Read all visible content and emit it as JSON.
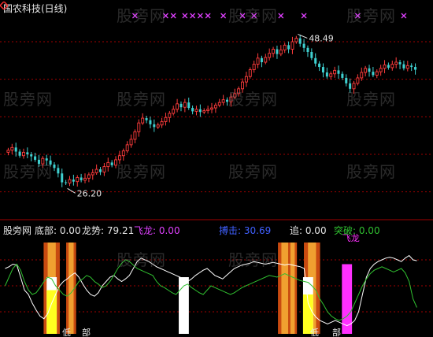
{
  "window": {
    "title": "国农科技(日线)"
  },
  "watermark": "股旁网",
  "colors": {
    "up": "#ff3c3c",
    "down": "#3fd0d0",
    "grid": "#a00000",
    "signal": "#e040ff",
    "line_white": "#ffffff",
    "line_green": "#30c030"
  },
  "chart_data": [
    {
      "type": "candlestick",
      "title": "国农科技(日线)",
      "ylim": [
        22,
        52
      ],
      "grid_levels": [
        25.5,
        31.0,
        36.5,
        42.0,
        47.5
      ],
      "annotations": {
        "high_label": "48.49",
        "low_label": "26.20"
      },
      "signal_markers": [
        33,
        41,
        43,
        46,
        48,
        50,
        52,
        56,
        61,
        64,
        71,
        77,
        91,
        103
      ],
      "closes": [
        31.6,
        32.0,
        31.4,
        30.8,
        31.3,
        31.0,
        30.7,
        30.2,
        29.6,
        30.4,
        30.1,
        29.5,
        29.0,
        28.2,
        26.9,
        26.8,
        27.3,
        27.0,
        27.6,
        27.2,
        27.5,
        28.0,
        28.3,
        28.8,
        28.4,
        29.2,
        29.8,
        29.4,
        30.2,
        30.8,
        31.5,
        32.4,
        33.2,
        34.3,
        35.6,
        36.3,
        36.0,
        35.4,
        35.0,
        35.3,
        35.8,
        36.4,
        37.0,
        37.6,
        38.4,
        37.9,
        38.6,
        37.8,
        37.3,
        37.6,
        37.2,
        37.4,
        37.6,
        37.8,
        38.2,
        38.6,
        39.0,
        38.7,
        39.4,
        39.9,
        40.6,
        41.6,
        42.4,
        43.4,
        44.2,
        45.1,
        44.5,
        45.2,
        45.8,
        46.4,
        45.7,
        46.3,
        47.0,
        46.4,
        47.5,
        48.0,
        47.2,
        46.6,
        46.0,
        45.1,
        44.3,
        43.8,
        43.0,
        42.4,
        42.8,
        43.3,
        42.8,
        42.2,
        41.4,
        40.6,
        41.4,
        42.2,
        43.0,
        43.6,
        43.1,
        42.6,
        43.1,
        43.6,
        44.1,
        43.7,
        44.2,
        44.5,
        44.2,
        43.6,
        44.0,
        43.8,
        43.4
      ]
    },
    {
      "type": "line",
      "legend": [
        {
          "label": "股旁网",
          "value": "",
          "color": "#e6e6e6"
        },
        {
          "label": "底部:",
          "value": "0.00",
          "color": "#e6e6e6"
        },
        {
          "label": "龙势:",
          "value": "79.21",
          "color": "#e6e6e6"
        },
        {
          "label": "飞龙:",
          "value": "0.00",
          "color": "#e040ff"
        },
        {
          "label": "搏击:",
          "value": "30.69",
          "color": "#4060ff"
        },
        {
          "label": "追:",
          "value": "0.00",
          "color": "#e6e6e6"
        },
        {
          "label": "突破:",
          "value": "0.00",
          "color": "#30c030"
        }
      ],
      "ylim": [
        0,
        100
      ],
      "grid_levels": [
        20,
        50,
        80
      ],
      "series": [
        {
          "name": "龙势",
          "color": "#ffffff",
          "values": [
            70,
            72,
            75,
            74,
            60,
            45,
            40,
            30,
            22,
            15,
            12,
            18,
            30,
            40,
            50,
            55,
            58,
            62,
            65,
            60,
            52,
            45,
            40,
            38,
            42,
            50,
            55,
            60,
            62,
            58,
            55,
            58,
            62,
            70,
            78,
            82,
            80,
            78,
            75,
            72,
            70,
            68,
            66,
            64,
            62,
            60,
            58,
            55,
            58,
            62,
            65,
            68,
            70,
            66,
            62,
            60,
            58,
            62,
            66,
            70,
            72,
            74,
            75,
            76,
            78,
            77,
            76,
            75,
            76,
            77,
            76,
            75,
            74,
            75,
            74,
            73,
            72,
            70,
            30,
            20,
            14,
            10,
            8,
            6,
            8,
            10,
            8,
            6,
            4,
            6,
            10,
            20,
            40,
            60,
            70,
            75,
            78,
            80,
            82,
            83,
            82,
            80,
            78,
            82,
            85,
            80,
            79
          ]
        },
        {
          "name": "突破",
          "color": "#30c030",
          "values": [
            50,
            60,
            70,
            75,
            68,
            55,
            45,
            40,
            42,
            48,
            55,
            60,
            58,
            50,
            45,
            40,
            38,
            42,
            48,
            55,
            58,
            62,
            60,
            55,
            52,
            48,
            50,
            55,
            62,
            70,
            76,
            80,
            78,
            74,
            70,
            68,
            66,
            64,
            62,
            55,
            50,
            48,
            45,
            42,
            40,
            45,
            50,
            52,
            48,
            45,
            42,
            40,
            45,
            50,
            48,
            46,
            44,
            42,
            40,
            42,
            45,
            48,
            50,
            52,
            54,
            56,
            58,
            60,
            62,
            61,
            60,
            62,
            64,
            62,
            60,
            58,
            56,
            55,
            54,
            50,
            45,
            35,
            28,
            20,
            15,
            12,
            10,
            12,
            15,
            20,
            30,
            40,
            50,
            58,
            64,
            68,
            70,
            72,
            70,
            68,
            66,
            68,
            70,
            65,
            55,
            35,
            25
          ]
        }
      ],
      "bars": [
        {
          "index": 12,
          "color": "#ffffff",
          "value": 60
        },
        {
          "index": 12,
          "color": "#ffff20",
          "value": 45
        },
        {
          "index": 46,
          "color": "#ffffff",
          "value": 60
        },
        {
          "index": 78,
          "color": "#ffffff",
          "value": 60
        },
        {
          "index": 78,
          "color": "#ffff20",
          "value": 40
        },
        {
          "index": 88,
          "color": "#ff30ff",
          "value": 75
        }
      ],
      "bands": [
        {
          "index": 12,
          "width": 2.6
        },
        {
          "index": 17,
          "width": 1.6
        },
        {
          "index": 72,
          "width": 2.2
        },
        {
          "index": 74,
          "width": 1.4
        },
        {
          "index": 79,
          "width": 2.6
        }
      ],
      "bottom_labels": [
        "低",
        "部",
        "低",
        "部"
      ],
      "peak_label": "飞龙"
    }
  ]
}
